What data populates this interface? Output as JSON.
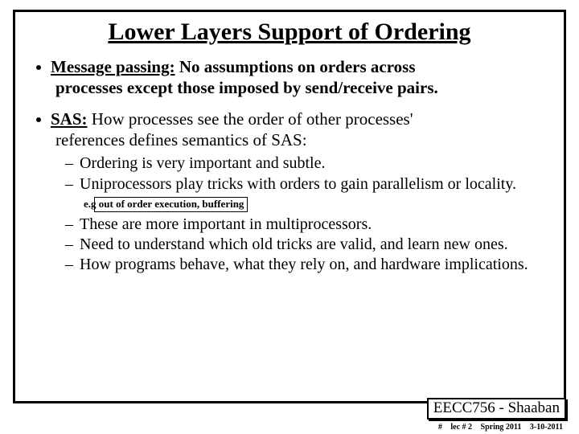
{
  "slide": {
    "title": "Lower Layers Support of Ordering",
    "bullets": [
      {
        "lead": "Message passing:",
        "text_first": "  No assumptions on orders across",
        "text_rest": "processes except those imposed by send/receive pairs."
      },
      {
        "lead": "SAS:",
        "text_first": "  How processes see the order of other processes'",
        "text_rest": "references defines semantics  of SAS:",
        "sub": [
          {
            "t": "Ordering is very important and subtle."
          },
          {
            "t": "Uniprocessors play tricks with orders to gain parallelism or locality.",
            "annot": "e.g out of order execution, buffering"
          },
          {
            "t": "These are more important in multiprocessors."
          },
          {
            "t": "Need to understand which old tricks are valid, and learn new ones."
          },
          {
            "t": "How programs behave, what they rely on, and hardware implications."
          }
        ]
      }
    ]
  },
  "footer": {
    "course": "EECC756 - Shaaban",
    "page": "#",
    "lec": "lec # 2",
    "term": "Spring 2011",
    "date": "3-10-2011"
  }
}
